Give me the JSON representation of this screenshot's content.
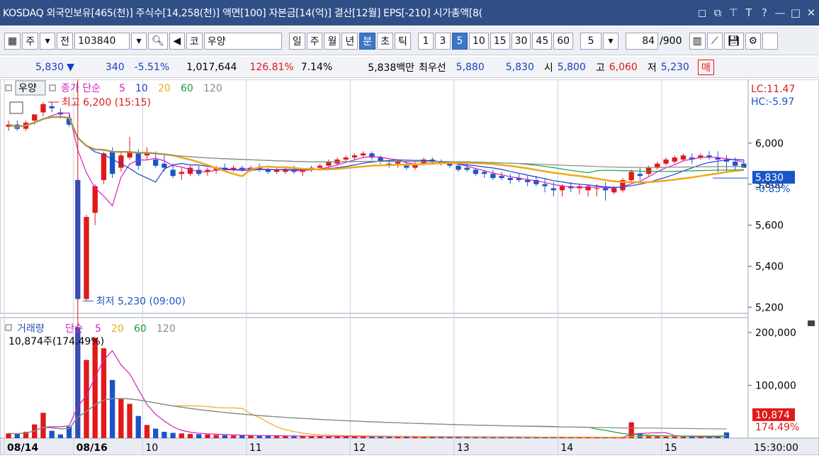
{
  "window": {
    "title": "KOSDAQ 외국인보유[465(천)] 주식수[14,258(천)] 액면[100] 자본금[14(억)] 결산[12월] EPS[-210] 시가총액[8(",
    "buttons": [
      "restore-icon",
      "popout-icon",
      "pin-icon",
      "font-icon",
      "help-icon",
      "minimize-icon",
      "maximize-icon",
      "close-icon"
    ],
    "button_glyphs": [
      "◻",
      "⧉",
      "⊤",
      "T",
      "?",
      "—",
      "□",
      "✕"
    ]
  },
  "toolbar": {
    "type_label": "주",
    "all_label": "전",
    "code": "103840",
    "market_label": "코",
    "stock_name": "우양",
    "period_tabs": [
      "일",
      "주",
      "월",
      "년",
      "분",
      "초",
      "틱"
    ],
    "selected_period": "분",
    "intervals": [
      "1",
      "3",
      "5",
      "10",
      "15",
      "30",
      "45",
      "60"
    ],
    "selected_interval": "5",
    "interval_select": "5",
    "count": "84",
    "count_total": "/900"
  },
  "quote": {
    "price": "5,830",
    "change": "340",
    "change_pct": "-5.51%",
    "volume": "1,017,644",
    "volume_ratio": "126.81%",
    "turnover": "7.14%",
    "amount": "5,838백만",
    "best_label": "최우선",
    "best_ask": "5,880",
    "best_bid": "5,830",
    "open_label": "시",
    "open": "5,800",
    "high_label": "고",
    "high": "6,060",
    "low_label": "저",
    "low": "5,230",
    "cut_label": "매"
  },
  "chart_data": [
    {
      "type": "candlestick",
      "title": "우양",
      "legend": {
        "price_label": "종가 단순",
        "ma": [
          "5",
          "10",
          "20",
          "60",
          "120"
        ],
        "ma_colors": [
          "#d21fbf",
          "#1f3fd0",
          "#f0a81a",
          "#1fa03a",
          "#8a8a8a"
        ]
      },
      "annotations": {
        "high_text": "최고 6,200 (15:15)",
        "low_text": "최저 5,230 (09:00)",
        "lc": "LC:11.47",
        "hc": "HC:-5.97",
        "last_price": "5,830",
        "last_change": "-0.85%"
      },
      "y_ticks": [
        "6,000",
        "5,800",
        "5,600",
        "5,400",
        "5,200"
      ],
      "ylim": [
        5170,
        6290
      ],
      "x_labels": [
        "08/14",
        "08/16",
        "10",
        "11",
        "12",
        "13",
        "14",
        "15"
      ],
      "time_label": "15:30:00",
      "up_color": "#e0191b",
      "down_color": "#1a55c8",
      "candles": [
        [
          6080,
          6110,
          6060,
          6090
        ],
        [
          6090,
          6110,
          6060,
          6070
        ],
        [
          6070,
          6110,
          6060,
          6100
        ],
        [
          6110,
          6140,
          6090,
          6140
        ],
        [
          6150,
          6200,
          6130,
          6190
        ],
        [
          6180,
          6200,
          6150,
          6170
        ],
        [
          6150,
          6170,
          6120,
          6140
        ],
        [
          6120,
          6150,
          6080,
          6090
        ],
        [
          5820,
          5830,
          5230,
          5240
        ],
        [
          5240,
          5650,
          5230,
          5640
        ],
        [
          5660,
          5800,
          5600,
          5790
        ],
        [
          5820,
          5960,
          5800,
          5950
        ],
        [
          5960,
          5980,
          5830,
          5850
        ],
        [
          5880,
          5960,
          5860,
          5940
        ],
        [
          5930,
          6030,
          5920,
          5960
        ],
        [
          5950,
          5970,
          5870,
          5890
        ],
        [
          5940,
          5980,
          5920,
          5950
        ],
        [
          5920,
          5960,
          5880,
          5890
        ],
        [
          5900,
          5940,
          5860,
          5880
        ],
        [
          5870,
          5900,
          5830,
          5840
        ],
        [
          5850,
          5880,
          5820,
          5860
        ],
        [
          5850,
          5890,
          5840,
          5880
        ],
        [
          5870,
          5890,
          5840,
          5850
        ],
        [
          5860,
          5880,
          5840,
          5870
        ],
        [
          5870,
          5890,
          5850,
          5880
        ],
        [
          5880,
          5900,
          5860,
          5870
        ],
        [
          5870,
          5890,
          5860,
          5880
        ],
        [
          5880,
          5890,
          5860,
          5870
        ],
        [
          5870,
          5890,
          5860,
          5880
        ],
        [
          5880,
          5900,
          5860,
          5870
        ],
        [
          5870,
          5880,
          5850,
          5860
        ],
        [
          5860,
          5880,
          5850,
          5870
        ],
        [
          5860,
          5880,
          5850,
          5870
        ],
        [
          5870,
          5890,
          5850,
          5860
        ],
        [
          5860,
          5880,
          5840,
          5870
        ],
        [
          5870,
          5890,
          5860,
          5880
        ],
        [
          5880,
          5900,
          5870,
          5890
        ],
        [
          5890,
          5920,
          5880,
          5910
        ],
        [
          5900,
          5930,
          5890,
          5920
        ],
        [
          5920,
          5940,
          5910,
          5930
        ],
        [
          5930,
          5950,
          5920,
          5940
        ],
        [
          5940,
          5960,
          5930,
          5950
        ],
        [
          5950,
          5960,
          5920,
          5930
        ],
        [
          5930,
          5940,
          5900,
          5910
        ],
        [
          5900,
          5920,
          5880,
          5890
        ],
        [
          5900,
          5920,
          5880,
          5910
        ],
        [
          5890,
          5910,
          5870,
          5880
        ],
        [
          5880,
          5910,
          5870,
          5900
        ],
        [
          5900,
          5930,
          5890,
          5920
        ],
        [
          5920,
          5930,
          5900,
          5910
        ],
        [
          5910,
          5920,
          5890,
          5900
        ],
        [
          5900,
          5910,
          5880,
          5890
        ],
        [
          5890,
          5900,
          5860,
          5870
        ],
        [
          5880,
          5900,
          5860,
          5870
        ],
        [
          5870,
          5880,
          5840,
          5850
        ],
        [
          5860,
          5870,
          5830,
          5850
        ],
        [
          5850,
          5870,
          5820,
          5830
        ],
        [
          5840,
          5860,
          5820,
          5830
        ],
        [
          5830,
          5850,
          5800,
          5820
        ],
        [
          5830,
          5850,
          5810,
          5820
        ],
        [
          5820,
          5840,
          5790,
          5810
        ],
        [
          5820,
          5840,
          5790,
          5800
        ],
        [
          5800,
          5830,
          5760,
          5790
        ],
        [
          5780,
          5810,
          5740,
          5770
        ],
        [
          5770,
          5800,
          5740,
          5790
        ],
        [
          5790,
          5810,
          5760,
          5780
        ],
        [
          5780,
          5800,
          5750,
          5790
        ],
        [
          5770,
          5800,
          5740,
          5790
        ],
        [
          5780,
          5800,
          5740,
          5780
        ],
        [
          5780,
          5810,
          5720,
          5770
        ],
        [
          5760,
          5790,
          5750,
          5780
        ],
        [
          5770,
          5830,
          5760,
          5820
        ],
        [
          5820,
          5870,
          5810,
          5860
        ],
        [
          5850,
          5880,
          5820,
          5840
        ],
        [
          5850,
          5890,
          5840,
          5880
        ],
        [
          5880,
          5910,
          5870,
          5900
        ],
        [
          5900,
          5930,
          5890,
          5920
        ],
        [
          5910,
          5940,
          5900,
          5930
        ],
        [
          5920,
          5950,
          5910,
          5940
        ],
        [
          5930,
          5950,
          5900,
          5920
        ],
        [
          5930,
          5950,
          5920,
          5940
        ],
        [
          5940,
          5960,
          5920,
          5930
        ],
        [
          5930,
          5960,
          5860,
          5920
        ],
        [
          5920,
          5940,
          5860,
          5910
        ],
        [
          5910,
          5930,
          5870,
          5890
        ],
        [
          5900,
          5920,
          5880,
          5880
        ]
      ]
    },
    {
      "type": "bar",
      "title": "거래량",
      "legend": {
        "ma_label": "단순",
        "ma": [
          "5",
          "20",
          "60",
          "120"
        ],
        "ma_colors": [
          "#d21fbf",
          "#f0a81a",
          "#1fa03a",
          "#8a8a8a"
        ]
      },
      "annotations": {
        "current": "10,874주(174.49%)",
        "last_value": "10,874",
        "last_pct": "174.49%"
      },
      "y_ticks": [
        "200,000",
        "100,000"
      ],
      "ylim": [
        0,
        220000
      ],
      "volumes": [
        9000,
        8000,
        12000,
        26000,
        48000,
        14000,
        7000,
        22000,
        210000,
        148000,
        190000,
        170000,
        110000,
        75000,
        65000,
        42000,
        25000,
        18000,
        12000,
        10000,
        9000,
        8000,
        7500,
        7000,
        6000,
        5500,
        5000,
        5000,
        4800,
        4500,
        4200,
        4000,
        4000,
        3800,
        3700,
        3600,
        3500,
        3400,
        3300,
        3200,
        3100,
        3000,
        2900,
        2800,
        2700,
        2600,
        2500,
        2500,
        2400,
        2300,
        2300,
        2200,
        2200,
        2100,
        2100,
        2000,
        2000,
        2000,
        2000,
        1900,
        1900,
        1900,
        1800,
        1800,
        1800,
        1800,
        1800,
        1700,
        1700,
        1700,
        1700,
        1600,
        30000,
        9000,
        6000,
        4000,
        3000,
        2800,
        2600,
        2500,
        2400,
        2300,
        2200,
        10874
      ]
    }
  ]
}
